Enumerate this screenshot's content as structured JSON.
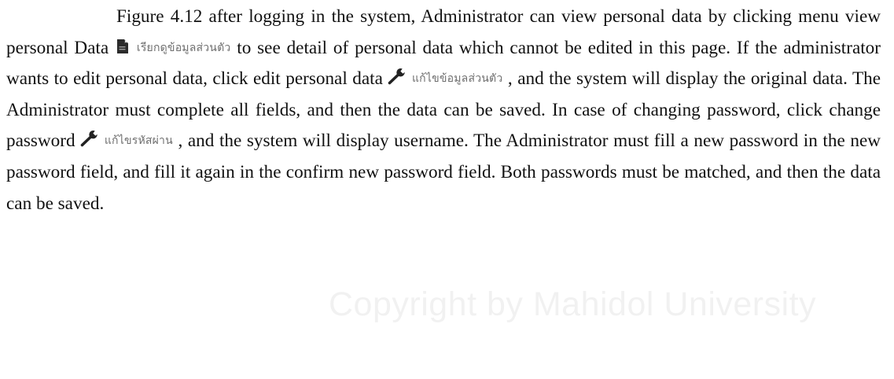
{
  "document": {
    "seg1": "Figure 4.12 after logging in the system, Administrator can view personal data by clicking menu view personal Data ",
    "label_view": "เรียกดูข้อมูลส่วนตัว",
    "seg2": " to see detail of personal data which cannot be edited in this page. If the administrator wants to edit personal data, click edit personal data ",
    "label_edit": "แก้ไขข้อมูลส่วนตัว",
    "seg3": " , and the system will display the original data. The Administrator must complete all fields, and then the data can be saved. In case of changing password, click change password ",
    "label_password": "แก้ไขรหัสผ่าน",
    "seg4": " , and the system will display username.  The Administrator must fill a new password in the new password field, and fill it again in the confirm new password field. Both passwords must be matched, and then the data can be saved."
  },
  "watermark": "Copyright by Mahidol University",
  "icons": {
    "view": "document-icon",
    "edit": "wrench-icon",
    "password": "wrench-icon"
  }
}
